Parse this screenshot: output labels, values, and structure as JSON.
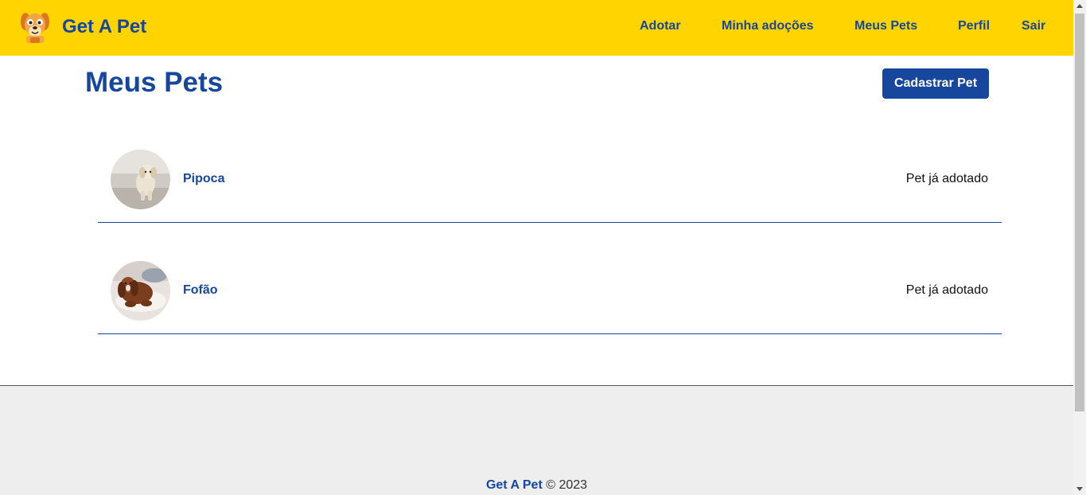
{
  "nav": {
    "brand": "Get A Pet",
    "logo_icon": "dog-face-icon",
    "items": [
      {
        "label": "Adotar"
      },
      {
        "label": "Minha adoções"
      },
      {
        "label": "Meus Pets"
      },
      {
        "label": "Perfil"
      },
      {
        "label": "Sair"
      }
    ]
  },
  "main": {
    "title": "Meus Pets",
    "add_button": "Cadastrar Pet",
    "pets": [
      {
        "name": "Pipoca",
        "status": "Pet já adotado",
        "photo": "puppy-photo"
      },
      {
        "name": "Fofão",
        "status": "Pet já adotado",
        "photo": "spaniel-photo"
      }
    ]
  },
  "footer": {
    "brand": "Get A Pet",
    "copyright": " © 2023"
  },
  "colors": {
    "navbar": "#ffd400",
    "primary": "#16479d",
    "footer_bg": "#eeeeee"
  }
}
